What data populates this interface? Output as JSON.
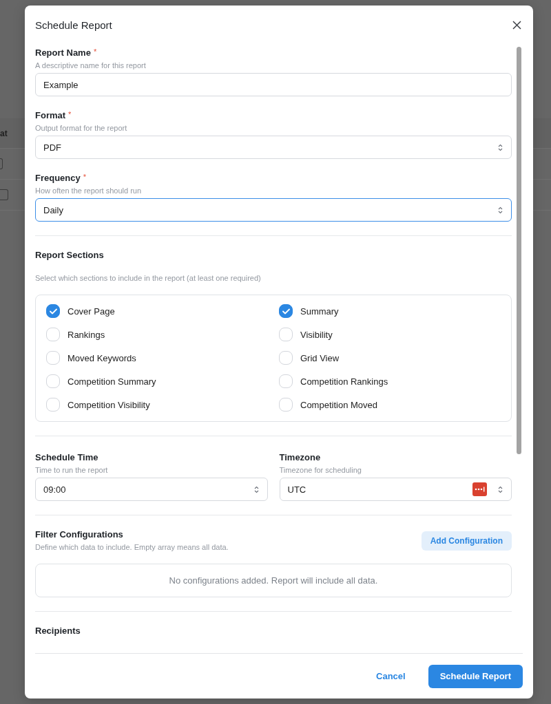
{
  "background_table": {
    "header_cell": "at"
  },
  "dialog": {
    "title": "Schedule Report"
  },
  "fields": [
    {
      "kind": "text",
      "label": "Report Name",
      "required_mark": "*",
      "hint": "A descriptive name for this report",
      "value": "Example",
      "focused": false
    },
    {
      "kind": "select",
      "label": "Format",
      "required_mark": "*",
      "hint": "Output format for the report",
      "value": "PDF",
      "focused": false
    },
    {
      "kind": "select",
      "label": "Frequency",
      "required_mark": "*",
      "hint": "How often the report should run",
      "value": "Daily",
      "focused": true
    }
  ],
  "report_sections": {
    "title": "Report Sections",
    "hint": "Select which sections to include in the report (at least one required)",
    "options": [
      {
        "label": "Cover Page",
        "checked": true
      },
      {
        "label": "Summary",
        "checked": true
      },
      {
        "label": "Rankings",
        "checked": false
      },
      {
        "label": "Visibility",
        "checked": false
      },
      {
        "label": "Moved Keywords",
        "checked": false
      },
      {
        "label": "Grid View",
        "checked": false
      },
      {
        "label": "Competition Summary",
        "checked": false
      },
      {
        "label": "Competition Rankings",
        "checked": false
      },
      {
        "label": "Competition Visibility",
        "checked": false
      },
      {
        "label": "Competition Moved",
        "checked": false
      }
    ]
  },
  "schedule": [
    {
      "kind": "select",
      "label": "Schedule Time",
      "hint": "Time to run the report",
      "value": "09:00",
      "focused": false
    },
    {
      "kind": "select",
      "label": "Timezone",
      "hint": "Timezone for scheduling",
      "value": "UTC",
      "focused": false,
      "extension_icon": true
    }
  ],
  "filter_configurations": {
    "title": "Filter Configurations",
    "hint": "Define which data to include. Empty array means all data.",
    "add_button": "Add Configuration",
    "empty_message": "No configurations added. Report will include all data."
  },
  "recipients": {
    "title": "Recipients"
  },
  "footer": {
    "buttons": [
      {
        "kind": "link",
        "label": "Cancel"
      },
      {
        "kind": "primary",
        "label": "Schedule Report"
      }
    ]
  }
}
